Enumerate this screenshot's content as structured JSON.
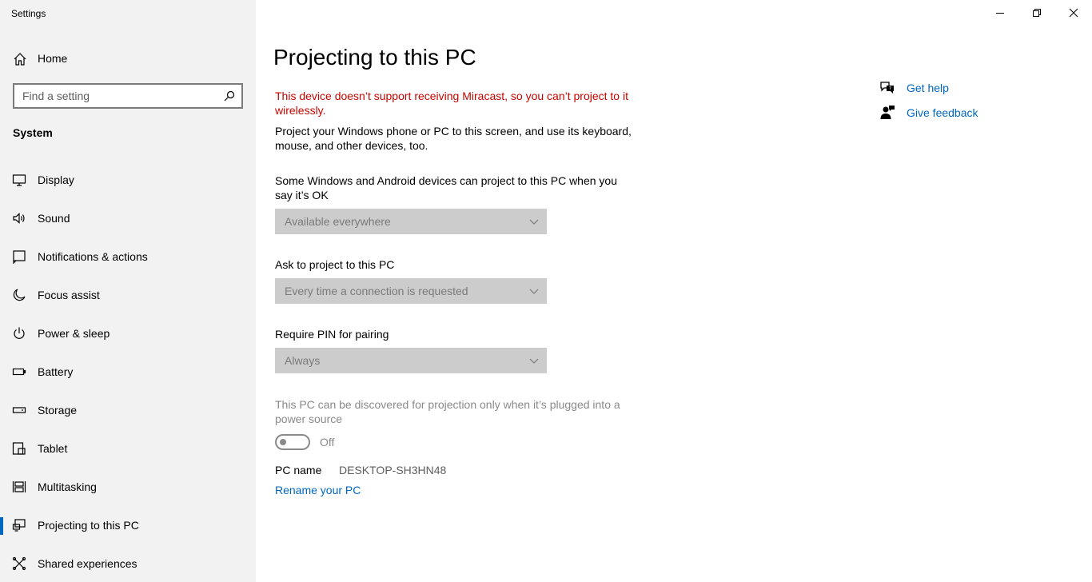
{
  "window": {
    "title": "Settings"
  },
  "sidebar": {
    "home_label": "Home",
    "search_placeholder": "Find a setting",
    "section_title": "System",
    "items": [
      {
        "label": "Display",
        "icon": "display-icon"
      },
      {
        "label": "Sound",
        "icon": "sound-icon"
      },
      {
        "label": "Notifications & actions",
        "icon": "notifications-icon"
      },
      {
        "label": "Focus assist",
        "icon": "moon-icon"
      },
      {
        "label": "Power & sleep",
        "icon": "power-icon"
      },
      {
        "label": "Battery",
        "icon": "battery-icon"
      },
      {
        "label": "Storage",
        "icon": "storage-icon"
      },
      {
        "label": "Tablet",
        "icon": "tablet-icon"
      },
      {
        "label": "Multitasking",
        "icon": "multitasking-icon"
      },
      {
        "label": "Projecting to this PC",
        "icon": "projecting-icon",
        "selected": true
      },
      {
        "label": "Shared experiences",
        "icon": "shared-experiences-icon"
      }
    ]
  },
  "main": {
    "title": "Projecting to this PC",
    "error_message": "This device doesn’t support receiving Miracast, so you can’t project to it wirelessly.",
    "description": "Project your Windows phone or PC to this screen, and use its keyboard, mouse, and other devices, too.",
    "availability_label": "Some Windows and Android devices can project to this PC when you say it’s OK",
    "availability_value": "Available everywhere",
    "ask_label": "Ask to project to this PC",
    "ask_value": "Every time a connection is requested",
    "pin_label": "Require PIN for pairing",
    "pin_value": "Always",
    "plugged_in_label": "This PC can be discovered for projection only when it’s plugged into a power source",
    "toggle_state": "Off",
    "pc_name_label": "PC name",
    "pc_name_value": "DESKTOP-SH3HN48",
    "rename_link": "Rename your PC"
  },
  "help": {
    "get_help": "Get help",
    "give_feedback": "Give feedback"
  },
  "colors": {
    "accent": "#0067c0",
    "error": "#c50500",
    "sidebar_bg": "#f2f2f2",
    "disabled_dropdown": "#cccccc"
  }
}
